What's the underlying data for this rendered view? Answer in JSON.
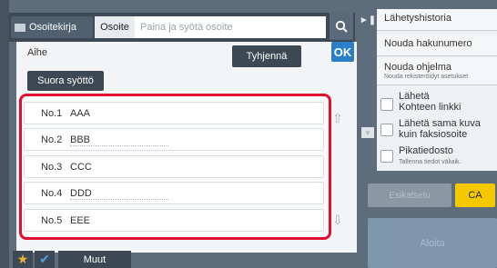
{
  "address_bar": {
    "addressbook_label": "Osoitekirja",
    "address_label": "Osoite",
    "address_placeholder": "Paina ja syötä osoite"
  },
  "dialog": {
    "subject_label": "Aihe",
    "clear_label": "Tyhjennä",
    "ok_label": "OK",
    "direct_entry_label": "Suora syöttö",
    "items": [
      {
        "num": "No.1",
        "name": "AAA"
      },
      {
        "num": "No.2",
        "name": "BBB"
      },
      {
        "num": "No.3",
        "name": "CCC"
      },
      {
        "num": "No.4",
        "name": "DDD"
      },
      {
        "num": "No.5",
        "name": "EEE"
      }
    ]
  },
  "bottom_bar": {
    "more_label": "Muut"
  },
  "right_panel": {
    "history_label": "Lähetyshistoria",
    "retrieve_number_label": "Nouda hakunumero",
    "retrieve_program_label": "Nouda ohjelma",
    "retrieve_program_sub": "Nouda rekisteröidyt asetukset",
    "send_link_label_1": "Lähetä",
    "send_link_label_2": "Kohteen linkki",
    "send_fax_label_1": "Lähetä sama kuva",
    "send_fax_label_2": "kuin faksiosoite",
    "quick_file_label": "Pikatiedosto",
    "quick_file_sub": "Tallenna tiedot väliaik.",
    "dim_button_label": "Esikatselu",
    "ca_label": "CA",
    "start_label": "Aloita"
  },
  "colors": {
    "highlight_border": "#e0102e",
    "ok_blue": "#2b7fc9",
    "ca_yellow": "#f5c800"
  }
}
